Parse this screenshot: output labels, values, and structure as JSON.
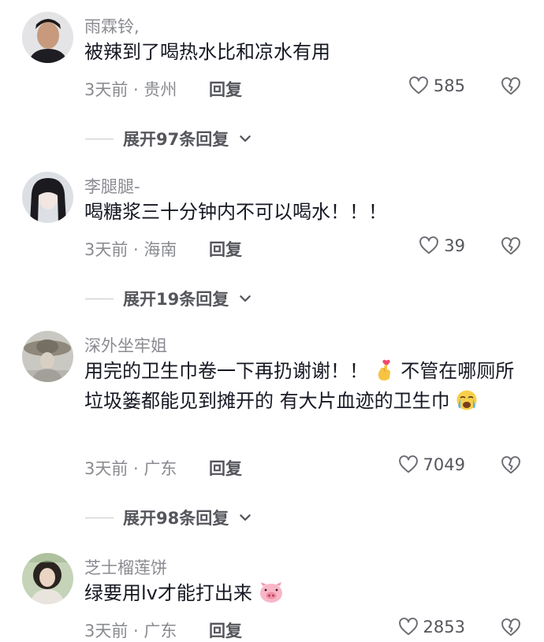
{
  "comments": [
    {
      "username": "雨霖铃,",
      "text": "被辣到了喝热水比和凉水有用",
      "meta": "3天前 · 贵州",
      "reply_label": "回复",
      "likes": "585",
      "expand_label": "展开97条回复"
    },
    {
      "username": "李腿腿-",
      "text": "喝糖浆三十分钟内不可以喝水！！！",
      "meta": "3天前 · 海南",
      "reply_label": "回复",
      "likes": "39",
      "expand_label": "展开19条回复"
    },
    {
      "username": "深外坐牢姐",
      "text_part1": "用完的卫生巾卷一下再扔谢谢！！",
      "text_part2": "不管在哪厕所垃圾篓都能见到摊开的 有大片血迹的卫生巾",
      "meta": "3天前 · 广东",
      "reply_label": "回复",
      "likes": "7049",
      "expand_label": "展开98条回复"
    },
    {
      "username": "芝士榴莲饼",
      "text": "绿要用lv才能打出来",
      "meta": "3天前 · 广东",
      "reply_label": "回复",
      "likes": "2853"
    }
  ]
}
